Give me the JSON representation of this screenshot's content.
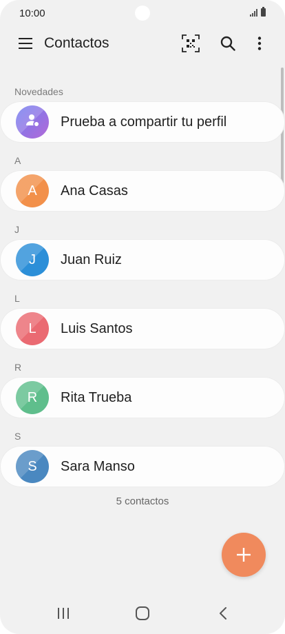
{
  "status_bar": {
    "time": "10:00"
  },
  "app_bar": {
    "title": "Contactos"
  },
  "sections": [
    {
      "header": "Novedades",
      "rows": [
        {
          "name": "Prueba a compartir tu perfil",
          "avatar_icon": "profile-share-icon",
          "avatar_color": "#8a6fe0"
        }
      ]
    },
    {
      "header": "A",
      "rows": [
        {
          "name": "Ana Casas",
          "initial": "A",
          "avatar_color": "#f2904a"
        }
      ]
    },
    {
      "header": "J",
      "rows": [
        {
          "name": "Juan Ruiz",
          "initial": "J",
          "avatar_color": "#2c8fd8"
        }
      ]
    },
    {
      "header": "L",
      "rows": [
        {
          "name": "Luis Santos",
          "initial": "L",
          "avatar_color": "#ea6a72"
        }
      ]
    },
    {
      "header": "R",
      "rows": [
        {
          "name": "Rita Trueba",
          "initial": "R",
          "avatar_color": "#5fbe8c"
        }
      ]
    },
    {
      "header": "S",
      "rows": [
        {
          "name": "Sara Manso",
          "initial": "S",
          "avatar_color": "#4a88c0"
        }
      ]
    }
  ],
  "footer": {
    "count_label": "5 contactos"
  },
  "fab": {
    "color": "#f08a5d",
    "icon": "plus-icon"
  },
  "nav": {
    "recents_icon": "recents-icon",
    "home_icon": "home-icon",
    "back_icon": "back-icon"
  }
}
